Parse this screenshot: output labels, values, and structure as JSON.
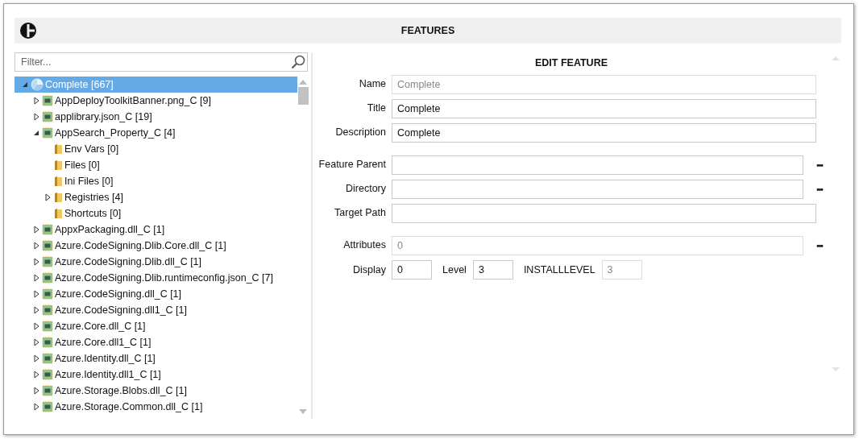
{
  "header": {
    "title": "FEATURES"
  },
  "filter": {
    "placeholder": "Filter..."
  },
  "tree": [
    {
      "label": "Complete [667]",
      "kind": "root",
      "expandable": true,
      "expanded": true,
      "selected": true,
      "children": [
        {
          "label": "AppDeployToolkitBanner.png_C [9]",
          "kind": "component",
          "expandable": true,
          "expanded": false,
          "selected": false
        },
        {
          "label": "applibrary.json_C [19]",
          "kind": "component",
          "expandable": true,
          "expanded": false,
          "selected": false
        },
        {
          "label": "AppSearch_Property_C [4]",
          "kind": "component",
          "expandable": true,
          "expanded": true,
          "selected": false,
          "children": [
            {
              "label": "Env Vars [0]",
              "kind": "folder",
              "expandable": false,
              "selected": false
            },
            {
              "label": "Files [0]",
              "kind": "folder",
              "expandable": false,
              "selected": false
            },
            {
              "label": "Ini Files [0]",
              "kind": "folder",
              "expandable": false,
              "selected": false
            },
            {
              "label": "Registries [4]",
              "kind": "folder",
              "expandable": true,
              "expanded": false,
              "selected": false
            },
            {
              "label": "Shortcuts [0]",
              "kind": "folder",
              "expandable": false,
              "selected": false
            }
          ]
        },
        {
          "label": "AppxPackaging.dll_C [1]",
          "kind": "component",
          "expandable": true,
          "expanded": false,
          "selected": false
        },
        {
          "label": "Azure.CodeSigning.Dlib.Core.dll_C [1]",
          "kind": "component",
          "expandable": true,
          "expanded": false,
          "selected": false
        },
        {
          "label": "Azure.CodeSigning.Dlib.dll_C [1]",
          "kind": "component",
          "expandable": true,
          "expanded": false,
          "selected": false
        },
        {
          "label": "Azure.CodeSigning.Dlib.runtimeconfig.json_C [7]",
          "kind": "component",
          "expandable": true,
          "expanded": false,
          "selected": false
        },
        {
          "label": "Azure.CodeSigning.dll_C [1]",
          "kind": "component",
          "expandable": true,
          "expanded": false,
          "selected": false
        },
        {
          "label": "Azure.CodeSigning.dll1_C [1]",
          "kind": "component",
          "expandable": true,
          "expanded": false,
          "selected": false
        },
        {
          "label": "Azure.Core.dll_C [1]",
          "kind": "component",
          "expandable": true,
          "expanded": false,
          "selected": false
        },
        {
          "label": "Azure.Core.dll1_C [1]",
          "kind": "component",
          "expandable": true,
          "expanded": false,
          "selected": false
        },
        {
          "label": "Azure.Identity.dll_C [1]",
          "kind": "component",
          "expandable": true,
          "expanded": false,
          "selected": false
        },
        {
          "label": "Azure.Identity.dll1_C [1]",
          "kind": "component",
          "expandable": true,
          "expanded": false,
          "selected": false
        },
        {
          "label": "Azure.Storage.Blobs.dll_C [1]",
          "kind": "component",
          "expandable": true,
          "expanded": false,
          "selected": false
        },
        {
          "label": "Azure.Storage.Common.dll_C [1]",
          "kind": "component",
          "expandable": true,
          "expanded": false,
          "selected": false
        }
      ]
    }
  ],
  "form": {
    "title": "EDIT FEATURE",
    "groups": [
      {
        "fields": [
          {
            "label": "Name",
            "value": "Complete",
            "disabled": true,
            "browse": false
          },
          {
            "label": "Title",
            "value": "Complete",
            "disabled": false,
            "browse": false
          },
          {
            "label": "Description",
            "value": "Complete",
            "disabled": false,
            "browse": false
          }
        ]
      },
      {
        "fields": [
          {
            "label": "Feature Parent",
            "disabled": false,
            "browse": true,
            "browse_label": "•••"
          },
          {
            "label": "Directory",
            "disabled": false,
            "browse": true,
            "browse_label": "•••"
          },
          {
            "label": "Target Path",
            "disabled": false,
            "browse": false
          }
        ]
      },
      {
        "fields": [
          {
            "label": "Attributes",
            "value": "0",
            "disabled": true,
            "browse": true,
            "browse_label": "•••"
          }
        ]
      }
    ],
    "small_fields": [
      {
        "label": "Display",
        "value": "0",
        "disabled": false
      },
      {
        "label": "Level",
        "value": "3",
        "disabled": false
      },
      {
        "label": "INSTALLLEVEL",
        "value": "3",
        "disabled": true
      }
    ]
  }
}
